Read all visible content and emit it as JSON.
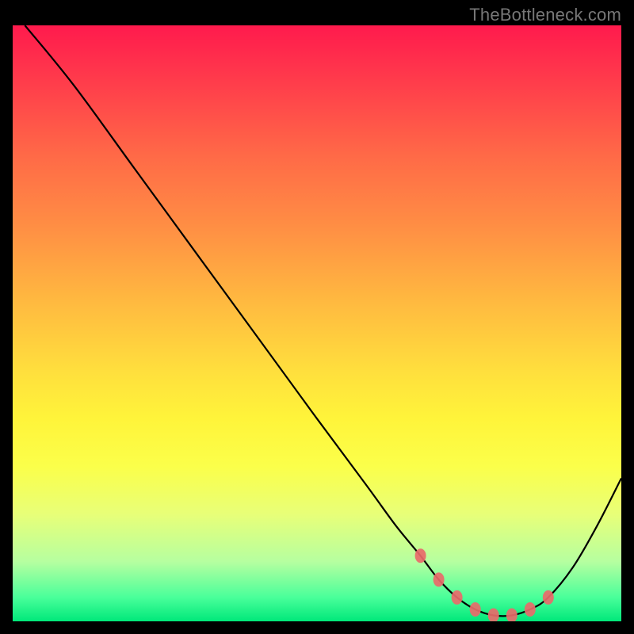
{
  "watermark": "TheBottleneck.com",
  "chart_data": {
    "type": "line",
    "title": "",
    "xlabel": "",
    "ylabel": "",
    "xlim": [
      0,
      100
    ],
    "ylim": [
      0,
      100
    ],
    "series": [
      {
        "name": "bottleneck-curve",
        "x": [
          2,
          10,
          20,
          30,
          40,
          50,
          58,
          63,
          67,
          70,
          73,
          76,
          79,
          82,
          85,
          88,
          92,
          96,
          100
        ],
        "y": [
          100,
          90,
          76,
          62,
          48,
          34,
          23,
          16,
          11,
          7,
          4,
          2,
          1,
          1,
          2,
          4,
          9,
          16,
          24
        ]
      }
    ],
    "markers": {
      "name": "highlight-dots",
      "color": "#e96a6a",
      "x": [
        67,
        70,
        73,
        76,
        79,
        82,
        85,
        88
      ],
      "y": [
        11,
        7,
        4,
        2,
        1,
        1,
        2,
        4
      ]
    }
  }
}
